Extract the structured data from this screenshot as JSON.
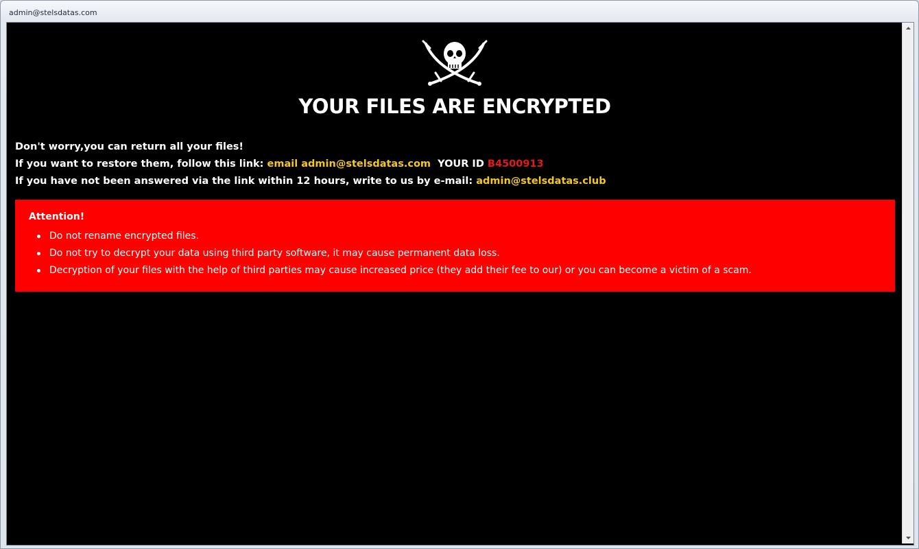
{
  "window": {
    "title": "admin@stelsdatas.com"
  },
  "note": {
    "headline": "YOUR FILES ARE ENCRYPTED",
    "line1": "Don't worry,you can return all your files!",
    "line2_prefix": "If you want to restore them, follow this link:",
    "line2_email": "email admin@stelsdatas.com",
    "line2_id_label": "YOUR ID",
    "line2_id_value": "B4500913",
    "line3_prefix": "If you have not been answered via the link within 12 hours, write to us by e-mail:",
    "line3_email": "admin@stelsdatas.club",
    "logo_icon": "skull-crossed-swords-icon"
  },
  "attention": {
    "title": "Attention!",
    "items": [
      "Do not rename encrypted files.",
      "Do not try to decrypt your data using third party software, it may cause permanent data loss.",
      "Decryption of your files with the help of third parties may cause increased price (they add their fee to our) or you can become a victim of a scam."
    ]
  },
  "colors": {
    "background": "#000000",
    "accent_yellow": "#f2c81f",
    "id_red": "#e01b1b",
    "attention_bg": "#ff0000"
  }
}
